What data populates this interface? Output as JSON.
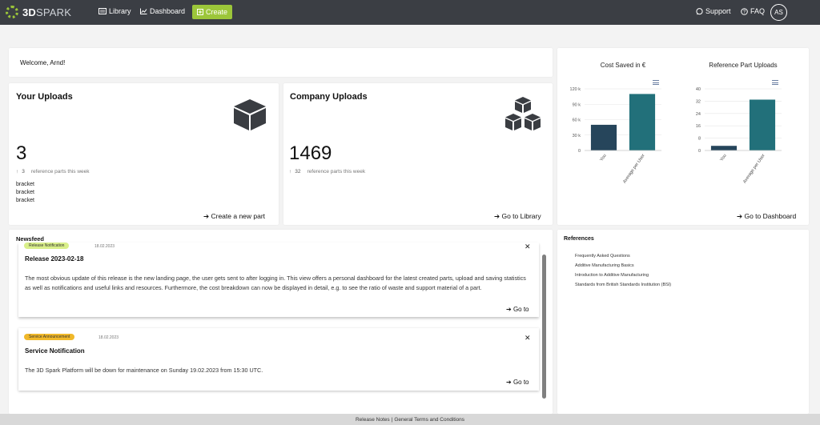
{
  "header": {
    "logo": {
      "text": "3D",
      "accent": "SPARK"
    },
    "nav": {
      "library": "Library",
      "dashboard": "Dashboard",
      "create": "Create"
    },
    "support": "Support",
    "faq": "FAQ",
    "avatar_initials": "AS"
  },
  "welcome": "Welcome, Arnd!",
  "your_uploads": {
    "title": "Your Uploads",
    "count": "3",
    "week_num": "3",
    "week_text": "reference parts this week",
    "parts": [
      "bracket",
      "bracket",
      "bracket"
    ],
    "link": "Create a new part",
    "icon": "cube-icon"
  },
  "company_uploads": {
    "title": "Company Uploads",
    "count": "1469",
    "week_num": "32",
    "week_text": "reference parts this week",
    "link": "Go to Library",
    "icon": "cubes-icon"
  },
  "charts_panel": {
    "link": "Go to Dashboard"
  },
  "chart_data": [
    {
      "type": "bar",
      "title": "Cost Saved in €",
      "categories": [
        "You",
        "Average per User"
      ],
      "values": [
        50000,
        110000
      ],
      "ylim": [
        0,
        120000
      ],
      "yticks": [
        0,
        30000,
        60000,
        90000,
        120000
      ],
      "ytick_labels": [
        "0",
        "30 k",
        "60 k",
        "90 k",
        "120 k"
      ],
      "colors": [
        "#26455b",
        "#22707a"
      ]
    },
    {
      "type": "bar",
      "title": "Reference Part Uploads",
      "categories": [
        "You",
        "Average per User"
      ],
      "values": [
        3,
        33
      ],
      "ylim": [
        0,
        40
      ],
      "yticks": [
        0,
        8,
        16,
        24,
        32,
        40
      ],
      "ytick_labels": [
        "0",
        "8",
        "16",
        "24",
        "32",
        "40"
      ],
      "colors": [
        "#26455b",
        "#22707a"
      ]
    }
  ],
  "newsfeed": {
    "title": "Newsfeed",
    "items": [
      {
        "badge": "Release Notification",
        "badge_color": "#d9ef8a",
        "date": "18.02.2023",
        "heading": "Release 2023-02-18",
        "body": "The most obvious update of this release is the new landing page, the user gets sent to after logging in. This view offers a personal dashboard for the latest created parts, upload and saving statistics as well as notifications and useful links and resources. Furthermore, the cost breakdown can now be displayed in detail, e.g. to see the ratio of waste and support material of a part.",
        "goto": "Go to"
      },
      {
        "badge": "Service Announcement",
        "badge_color": "#f0b82a",
        "date": "18.02.2023",
        "heading": "Service Notification",
        "body": "The 3D Spark Platform will be down for maintenance on Sunday 19.02.2023 from 15:30 UTC.",
        "goto": "Go to"
      }
    ]
  },
  "references": {
    "title": "References",
    "items": [
      "Frequently Asked Questions",
      "Additive Manufacturing Basics",
      "Introduction to Additive Manufacturing",
      "Standards from British Standards Institution (BSI)"
    ]
  },
  "footer": {
    "release_notes": "Release Notes",
    "separator": "|",
    "terms": "General Terms and Conditions"
  }
}
